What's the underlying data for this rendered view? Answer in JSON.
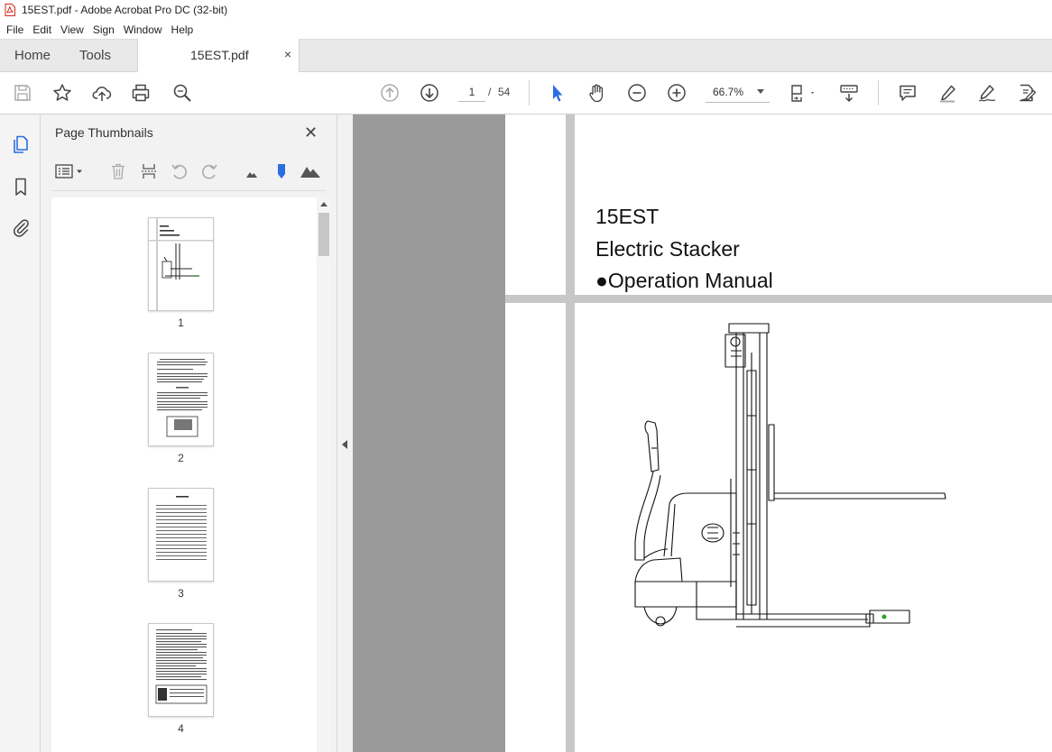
{
  "window": {
    "title": "15EST.pdf - Adobe Acrobat Pro DC (32-bit)"
  },
  "menu": [
    "File",
    "Edit",
    "View",
    "Sign",
    "Window",
    "Help"
  ],
  "tabs": {
    "home": "Home",
    "tools": "Tools",
    "document": "15EST.pdf",
    "close_symbol": "×"
  },
  "toolbar": {
    "current_page": "1",
    "page_separator": "/",
    "total_pages": "54",
    "zoom": "66.7%"
  },
  "thumbnails": {
    "title": "Page Thumbnails",
    "close_symbol": "✕",
    "pages": [
      "1",
      "2",
      "3",
      "4"
    ]
  },
  "document": {
    "line1": "15EST",
    "line2": "Electric Stacker",
    "line3": "●Operation Manual"
  },
  "colors": {
    "accent_blue": "#2d6ee0",
    "pdf_red": "#d4261c",
    "canvas_gray": "#9a9a9a"
  }
}
